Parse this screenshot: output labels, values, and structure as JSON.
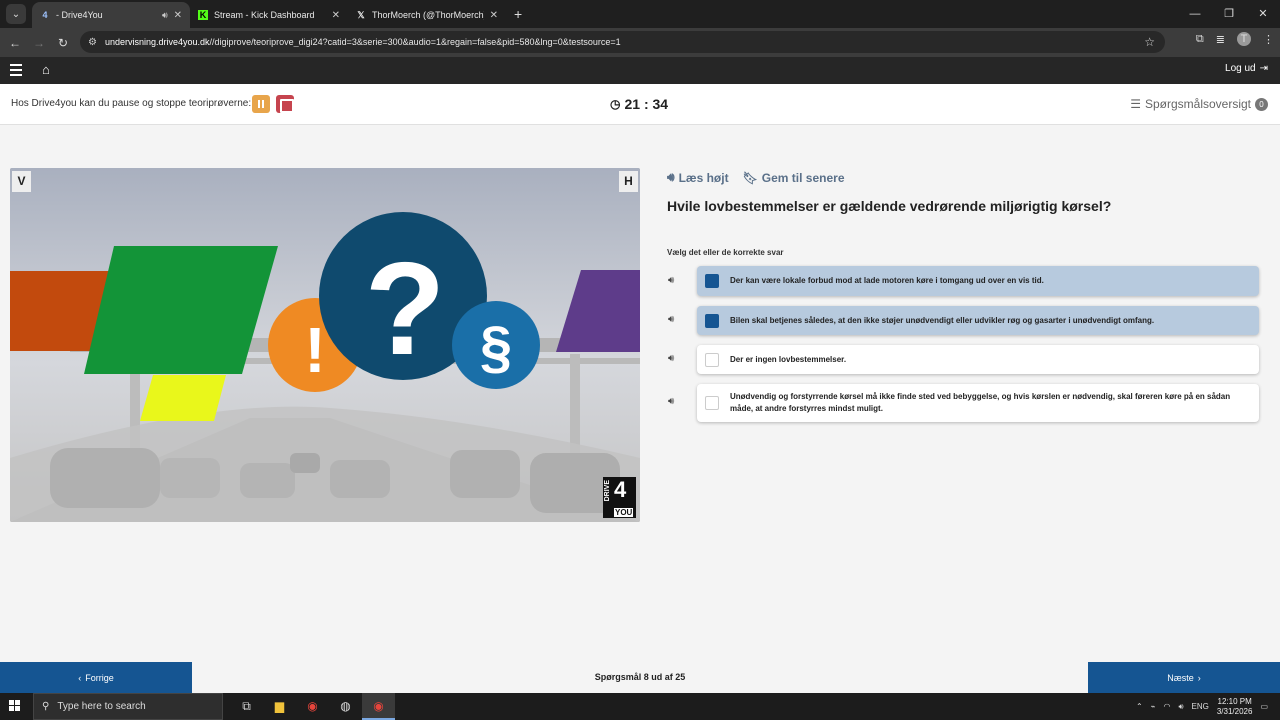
{
  "browser": {
    "tabs": [
      {
        "title": "- Drive4You",
        "icon": "drive4you-favicon",
        "active": true,
        "audio": true
      },
      {
        "title": "Stream - Kick Dashboard",
        "icon": "kick-favicon",
        "active": false
      },
      {
        "title": "ThorMoerch (@ThorMoerch) /",
        "icon": "x-favicon",
        "active": false
      }
    ],
    "url_host": "undervisning.drive4you.dk",
    "url_path": "//digiprove/teoriprove_digi24?catid=3&serie=300&audio=1&regain=false&pid=580&lng=0&testsource=1",
    "profile_initial": "T"
  },
  "site": {
    "logout_label": "Log ud",
    "pause_text": "Hos Drive4you kan du pause og stoppe teoriprøverne:",
    "timer": "21 : 34",
    "overview_label": "Spørgsmålsoversigt",
    "overview_count": "0"
  },
  "illustration": {
    "left_marker": "V",
    "right_marker": "H",
    "logo_text_top": "DRIVE",
    "logo_text_num": "4",
    "logo_text_bottom": "YOU",
    "question_mark": "?",
    "exclamation": "!",
    "paragraph_sign": "§"
  },
  "question": {
    "read_aloud": "Læs højt",
    "save_later": "Gem til senere",
    "text": "Hvile lovbestemmelser er gældende vedrørende miljørigtig kørsel?",
    "instruction": "Vælg det eller de korrekte svar",
    "answers": [
      {
        "text": "Der kan være lokale forbud mod at lade motoren køre i tomgang ud over en vis tid.",
        "selected": true
      },
      {
        "text": "Bilen skal betjenes således, at den ikke støjer unødvendigt eller udvikler røg og gasarter i unødvendigt omfang.",
        "selected": true
      },
      {
        "text": "Der er ingen lovbestemmelser.",
        "selected": false
      },
      {
        "text": "Unødvendig og forstyrrende kørsel må ikke finde sted ved bebyggelse, og hvis kørslen er nødvendig, skal føreren køre på en sådan måde, at andre forstyrres mindst muligt.",
        "selected": false
      }
    ]
  },
  "footer": {
    "prev_label": "Forrige",
    "next_label": "Næste",
    "progress": "Spørgsmål 8 ud af 25"
  },
  "taskbar": {
    "search_placeholder": "Type here to search",
    "lang": "ENG",
    "time": "12:10 PM",
    "date": "3/31/2026"
  },
  "colors": {
    "primary": "#155592",
    "pause": "#e8a54b",
    "stop": "#c6444e",
    "selected_answer_bg": "#b7cade"
  }
}
